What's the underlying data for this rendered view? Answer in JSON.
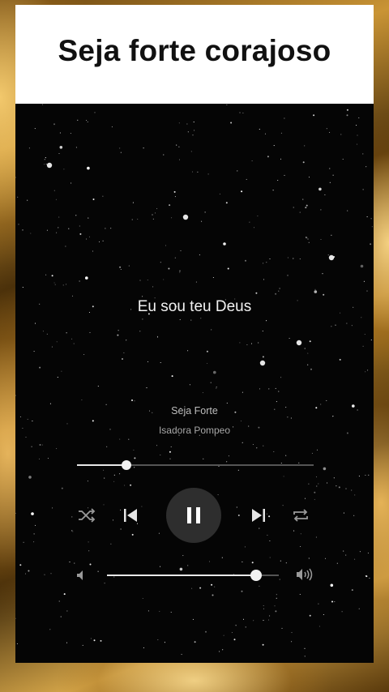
{
  "header": {
    "title": "Seja forte corajoso"
  },
  "lyrics": {
    "current_line": "Eu sou teu Deus"
  },
  "track": {
    "title": "Seja Forte",
    "artist": "Isadora Pompeo"
  },
  "playback": {
    "progress_fraction": 0.21,
    "state": "playing",
    "volume_fraction": 0.87
  },
  "controls": {
    "shuffle_icon": "shuffle-icon",
    "previous_icon": "skip-previous-icon",
    "pause_icon": "pause-icon",
    "next_icon": "skip-next-icon",
    "repeat_icon": "repeat-icon",
    "volume_low_icon": "volume-low-icon",
    "volume_high_icon": "volume-high-icon"
  },
  "colors": {
    "title_background": "#ffffff",
    "player_background": "#050505",
    "accent": "#f2f2f2",
    "frame_gold": "#c99435"
  }
}
